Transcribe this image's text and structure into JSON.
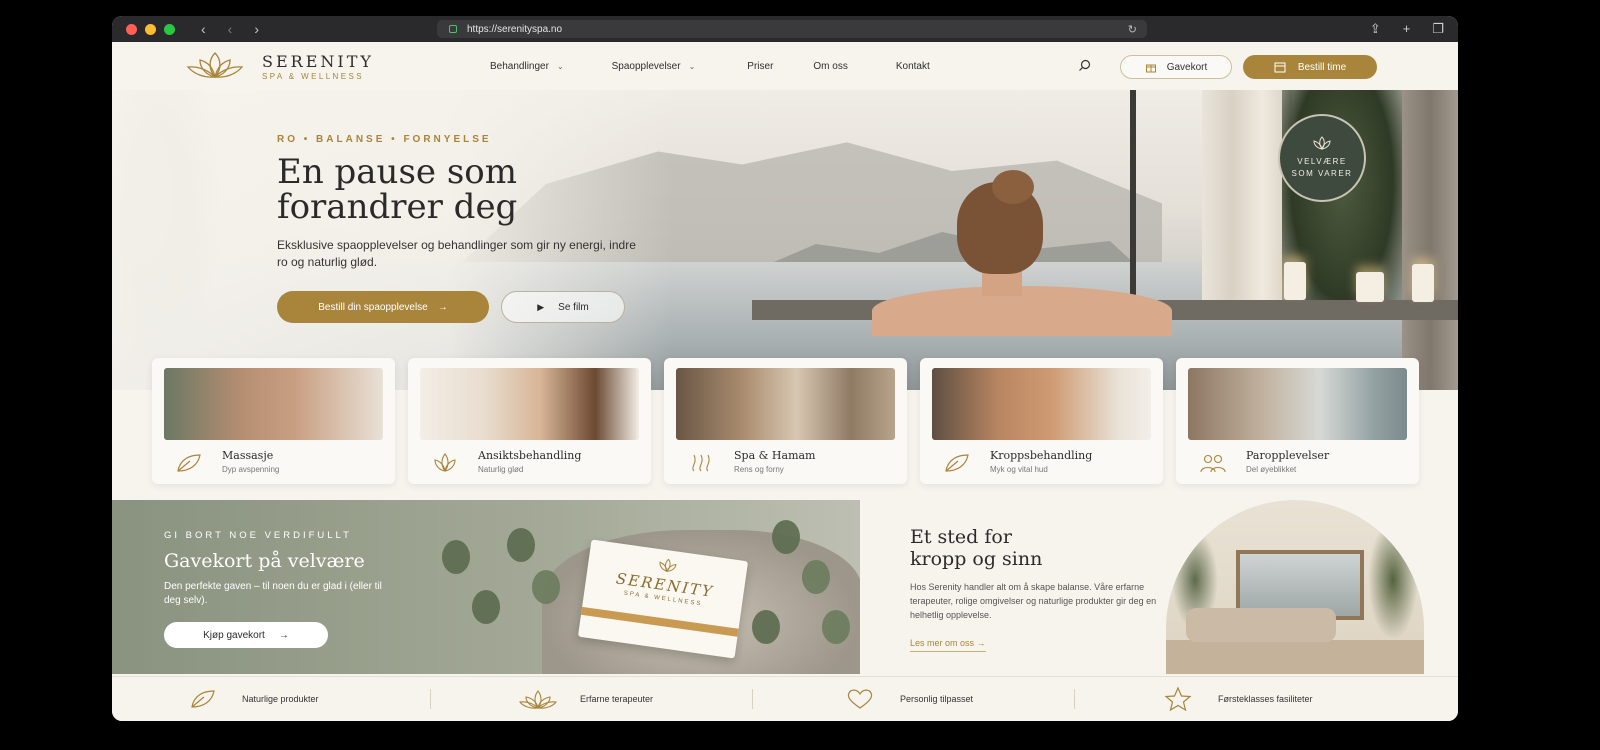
{
  "browser": {
    "url": "https://serenityspa.no"
  },
  "brand": {
    "name": "SERENITY",
    "tagline": "SPA & WELLNESS",
    "accent": "#a8853a"
  },
  "nav": {
    "items": [
      {
        "label": "Behandlinger",
        "dropdown": true
      },
      {
        "label": "Spaopplevelser",
        "dropdown": true
      },
      {
        "label": "Priser",
        "dropdown": false
      },
      {
        "label": "Om oss",
        "dropdown": false
      },
      {
        "label": "Kontakt",
        "dropdown": false
      }
    ],
    "gift_label": "Gavekort",
    "book_label": "Bestill time"
  },
  "hero": {
    "eyebrow": "RO • BALANSE • FORNYELSE",
    "title_line1": "En pause som",
    "title_line2": "forandrer deg",
    "subtitle": "Eksklusive spaopplevelser og behandlinger som gir ny energi, indre ro og naturlig glød.",
    "primary_cta": "Bestill din spaopplevelse",
    "secondary_cta": "Se film",
    "badge_line1": "VELVÆRE",
    "badge_line2": "SOM VARER"
  },
  "cards": [
    {
      "title": "Massasje",
      "subtitle": "Dyp avspenning",
      "icon": "leaf-icon"
    },
    {
      "title": "Ansiktsbehandling",
      "subtitle": "Naturlig glød",
      "icon": "lotus-icon"
    },
    {
      "title": "Spa & Hamam",
      "subtitle": "Rens og forny",
      "icon": "steam-icon"
    },
    {
      "title": "Kroppsbehandling",
      "subtitle": "Myk og vital hud",
      "icon": "leaf-icon"
    },
    {
      "title": "Paropplevelser",
      "subtitle": "Del øyeblikket",
      "icon": "couple-icon"
    }
  ],
  "gift": {
    "eyebrow": "GI BORT NOE VERDIFULLT",
    "title": "Gavekort på velvære",
    "subtitle": "Den perfekte gaven – til noen du er glad i (eller til deg selv).",
    "button": "Kjøp gavekort",
    "card_name": "SERENITY",
    "card_sub": "SPA & WELLNESS"
  },
  "about": {
    "title_line1": "Et sted for",
    "title_line2": "kropp og sinn",
    "body": "Hos Serenity handler alt om å skape balanse. Våre erfarne terapeuter, rolige omgivelser og naturlige produkter gir deg en helhetlig opplevelse.",
    "link": "Les mer om oss"
  },
  "features": [
    {
      "label": "Naturlige produkter",
      "icon": "leaf-icon"
    },
    {
      "label": "Erfarne terapeuter",
      "icon": "lotus-icon"
    },
    {
      "label": "Personlig tilpasset",
      "icon": "heart-icon"
    },
    {
      "label": "Førsteklasses fasiliteter",
      "icon": "star-icon"
    }
  ]
}
